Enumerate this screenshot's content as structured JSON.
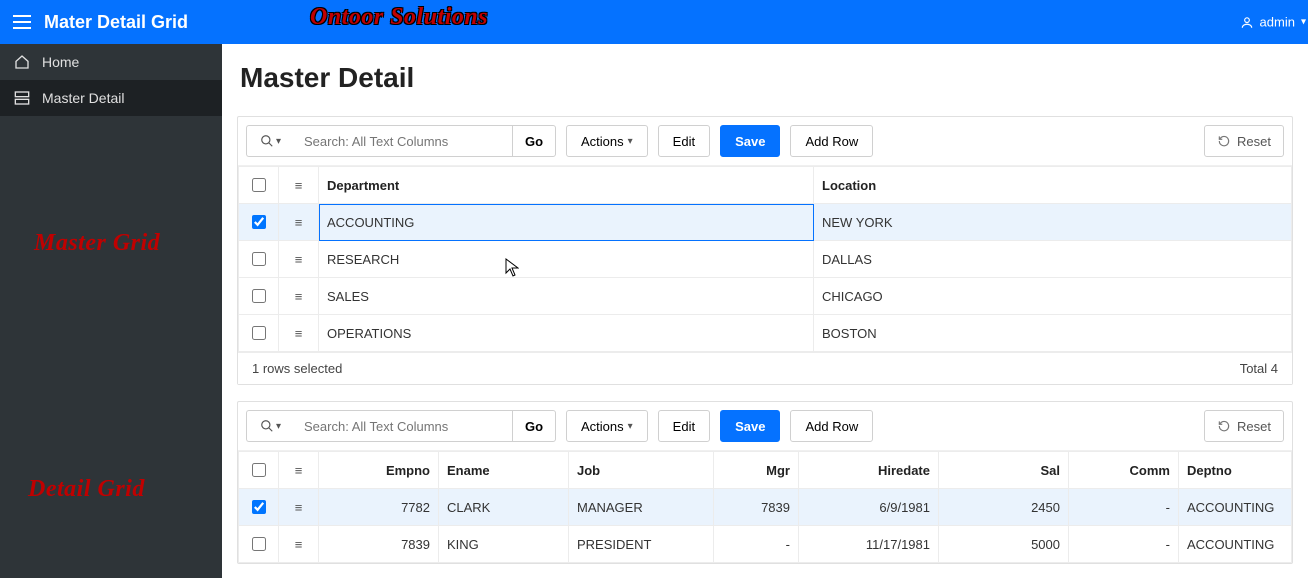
{
  "header": {
    "app_title": "Mater Detail Grid",
    "brand": "Ontoor Solutions",
    "user_label": "admin"
  },
  "sidebar": {
    "items": [
      {
        "label": "Home",
        "active": false
      },
      {
        "label": "Master Detail",
        "active": true
      }
    ],
    "annotation_master": "Master Grid",
    "annotation_detail": "Detail Grid"
  },
  "page": {
    "title": "Master Detail"
  },
  "master_grid": {
    "toolbar": {
      "search_placeholder": "Search: All Text Columns",
      "go": "Go",
      "actions": "Actions",
      "edit": "Edit",
      "save": "Save",
      "add_row": "Add Row",
      "reset": "Reset"
    },
    "headers": {
      "department": "Department",
      "location": "Location"
    },
    "rows": [
      {
        "department": "ACCOUNTING",
        "location": "NEW YORK",
        "checked": true,
        "selected": true
      },
      {
        "department": "RESEARCH",
        "location": "DALLAS",
        "checked": false,
        "selected": false
      },
      {
        "department": "SALES",
        "location": "CHICAGO",
        "checked": false,
        "selected": false
      },
      {
        "department": "OPERATIONS",
        "location": "BOSTON",
        "checked": false,
        "selected": false
      }
    ],
    "footer_left": "1 rows selected",
    "footer_right": "Total 4"
  },
  "detail_grid": {
    "toolbar": {
      "search_placeholder": "Search: All Text Columns",
      "go": "Go",
      "actions": "Actions",
      "edit": "Edit",
      "save": "Save",
      "add_row": "Add Row",
      "reset": "Reset"
    },
    "headers": {
      "empno": "Empno",
      "ename": "Ename",
      "job": "Job",
      "mgr": "Mgr",
      "hiredate": "Hiredate",
      "sal": "Sal",
      "comm": "Comm",
      "deptno": "Deptno"
    },
    "rows": [
      {
        "empno": "7782",
        "ename": "CLARK",
        "job": "MANAGER",
        "mgr": "7839",
        "hiredate": "6/9/1981",
        "sal": "2450",
        "comm": "-",
        "deptno": "ACCOUNTING",
        "checked": true
      },
      {
        "empno": "7839",
        "ename": "KING",
        "job": "PRESIDENT",
        "mgr": "-",
        "hiredate": "11/17/1981",
        "sal": "5000",
        "comm": "-",
        "deptno": "ACCOUNTING",
        "checked": false
      }
    ]
  },
  "chart_data": {
    "type": "table",
    "master": {
      "columns": [
        "Department",
        "Location"
      ],
      "rows": [
        [
          "ACCOUNTING",
          "NEW YORK"
        ],
        [
          "RESEARCH",
          "DALLAS"
        ],
        [
          "SALES",
          "CHICAGO"
        ],
        [
          "OPERATIONS",
          "BOSTON"
        ]
      ]
    },
    "detail": {
      "columns": [
        "Empno",
        "Ename",
        "Job",
        "Mgr",
        "Hiredate",
        "Sal",
        "Comm",
        "Deptno"
      ],
      "rows": [
        [
          7782,
          "CLARK",
          "MANAGER",
          7839,
          "6/9/1981",
          2450,
          null,
          "ACCOUNTING"
        ],
        [
          7839,
          "KING",
          "PRESIDENT",
          null,
          "11/17/1981",
          5000,
          null,
          "ACCOUNTING"
        ]
      ]
    }
  }
}
